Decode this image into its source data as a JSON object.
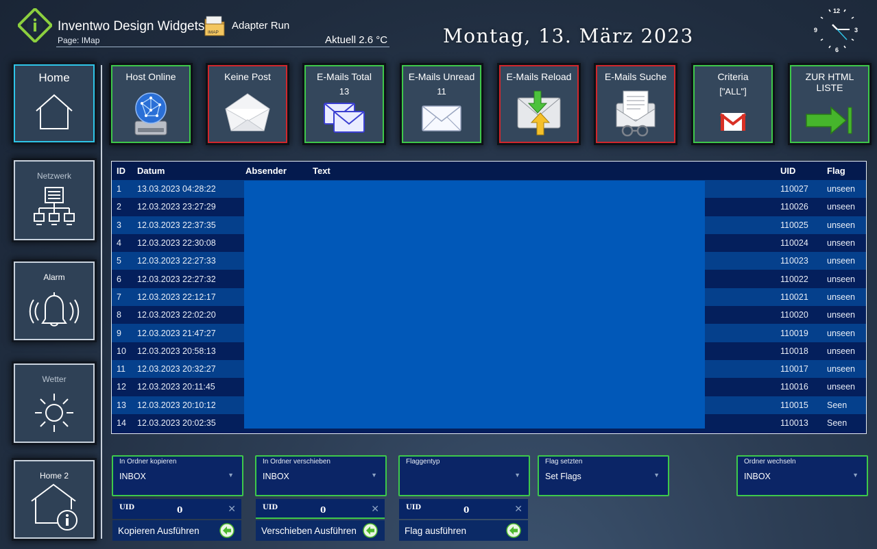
{
  "header": {
    "app_title": "Inventwo Design Widgets",
    "page_label": "Page: IMap",
    "adapter_label": "Adapter Run",
    "adapter_icon_text": "IMAP",
    "temperature": "Aktuell 2.6 °C",
    "date": "Montag, 13. März 2023",
    "clock": {
      "n12": "12",
      "n3": "3",
      "n6": "6",
      "n9": "9"
    }
  },
  "nav": [
    {
      "label": "Home",
      "icon": "house-icon",
      "active": true
    },
    {
      "label": "Netzwerk",
      "icon": "network-icon"
    },
    {
      "label": "Alarm",
      "icon": "bell-icon"
    },
    {
      "label": "Wetter",
      "icon": "sun-icon"
    },
    {
      "label": "Home 2",
      "icon": "house-info-icon"
    }
  ],
  "tiles": [
    {
      "title": "Host Online",
      "value": "",
      "icon": "server-globe-icon",
      "border": "#3ec94a"
    },
    {
      "title": "Keine Post",
      "value": "",
      "icon": "open-envelope-icon",
      "border": "#d2272c"
    },
    {
      "title": "E-Mails Total",
      "value": "13",
      "icon": "envelopes-icon",
      "border": "#3ec94a"
    },
    {
      "title": "E-Mails Unread",
      "value": "11",
      "icon": "envelope-icon",
      "border": "#3ec94a"
    },
    {
      "title": "E-Mails Reload",
      "value": "",
      "icon": "mail-sync-icon",
      "border": "#d2272c"
    },
    {
      "title": "E-Mails Suche",
      "value": "",
      "icon": "mail-search-icon",
      "border": "#d2272c"
    },
    {
      "title": "Criteria",
      "value": "[\"ALL\"]",
      "icon": "gmail-icon",
      "border": "#3ec94a"
    },
    {
      "title": "ZUR HTML LISTE",
      "value": "",
      "icon": "arrow-right-icon",
      "border": "#3ec94a"
    }
  ],
  "table": {
    "headers": [
      "ID",
      "Datum",
      "Absender",
      "Text",
      "UID",
      "Flag"
    ],
    "rows": [
      [
        "1",
        "13.03.2023 04:28:22",
        "",
        "",
        "110027",
        "unseen"
      ],
      [
        "2",
        "12.03.2023 23:27:29",
        "",
        "",
        "110026",
        "unseen"
      ],
      [
        "3",
        "12.03.2023 22:37:35",
        "",
        "",
        "110025",
        "unseen"
      ],
      [
        "4",
        "12.03.2023 22:30:08",
        "",
        "",
        "110024",
        "unseen"
      ],
      [
        "5",
        "12.03.2023 22:27:33",
        "",
        "",
        "110023",
        "unseen"
      ],
      [
        "6",
        "12.03.2023 22:27:32",
        "",
        "",
        "110022",
        "unseen"
      ],
      [
        "7",
        "12.03.2023 22:12:17",
        "",
        "",
        "110021",
        "unseen"
      ],
      [
        "8",
        "12.03.2023 22:02:20",
        "",
        "",
        "110020",
        "unseen"
      ],
      [
        "9",
        "12.03.2023 21:47:27",
        "",
        "",
        "110019",
        "unseen"
      ],
      [
        "10",
        "12.03.2023 20:58:13",
        "",
        "",
        "110018",
        "unseen"
      ],
      [
        "11",
        "12.03.2023 20:32:27",
        "",
        "",
        "110017",
        "unseen"
      ],
      [
        "12",
        "12.03.2023 20:11:45",
        "",
        "",
        "110016",
        "unseen"
      ],
      [
        "13",
        "12.03.2023 20:10:12",
        "",
        "",
        "110015",
        "Seen"
      ],
      [
        "14",
        "12.03.2023 20:02:35",
        "",
        "",
        "110013",
        "Seen"
      ]
    ]
  },
  "selects": [
    {
      "label": "In Ordner kopieren",
      "value": "INBOX"
    },
    {
      "label": "In Ordner verschieben",
      "value": "INBOX"
    },
    {
      "label": "Flaggentyp",
      "value": ""
    },
    {
      "label": "Flag setzten",
      "value": "Set Flags"
    },
    {
      "label": "Ordner wechseln",
      "value": "INBOX"
    }
  ],
  "uid_fields": [
    {
      "label": "UID",
      "value": "0"
    },
    {
      "label": "UID",
      "value": "0"
    },
    {
      "label": "UID",
      "value": "0"
    }
  ],
  "actions": [
    {
      "label": "Kopieren Ausführen"
    },
    {
      "label": "Verschieben Ausführen"
    },
    {
      "label": "Flag ausführen"
    }
  ],
  "colors": {
    "active_border": "#2ec5e8",
    "ok_border": "#3ec94a",
    "alert_border": "#d2272c",
    "table_row_a": "#05408c",
    "table_row_b": "#041f5c"
  }
}
